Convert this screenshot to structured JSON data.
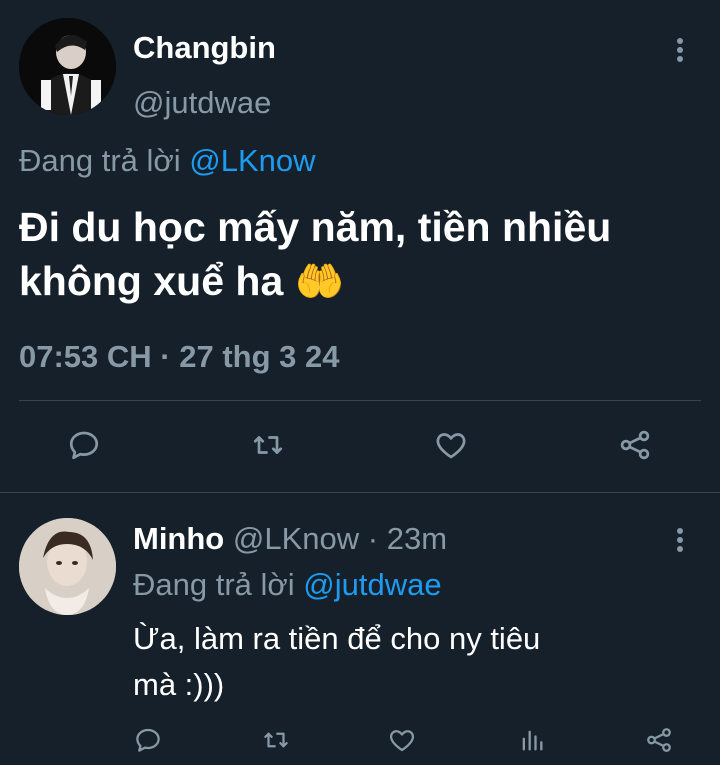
{
  "main_tweet": {
    "author_name": "Changbin",
    "handle": "@jutdwae",
    "replying_prefix": "Đang trả lời",
    "replying_to": "@LKnow",
    "text_line1": "Đi du học mấy năm, tiền nhiều",
    "text_line2": "không xuể ha",
    "emoji": "🤲",
    "timestamp": "07:53 CH · 27 thg 3 24",
    "more_icon": "more-vertical-icon",
    "actions": [
      "reply-icon",
      "retweet-icon",
      "like-icon",
      "share-icon"
    ]
  },
  "reply_tweet": {
    "author_name": "Minho",
    "handle": "@LKnow",
    "separator": "·",
    "time_ago": "23m",
    "replying_prefix": "Đang trả lời",
    "replying_to": "@jutdwae",
    "text_line1": "Ừa, làm ra tiền để cho ny tiêu",
    "text_line2": "mà :)))",
    "more_icon": "more-vertical-icon",
    "actions": [
      "reply-icon",
      "retweet-icon",
      "like-icon",
      "analytics-icon",
      "share-icon"
    ]
  },
  "colors": {
    "background": "#15202b",
    "text": "#ffffff",
    "muted": "#8899a6",
    "accent": "#1d9bf0",
    "divider": "#38444d"
  }
}
